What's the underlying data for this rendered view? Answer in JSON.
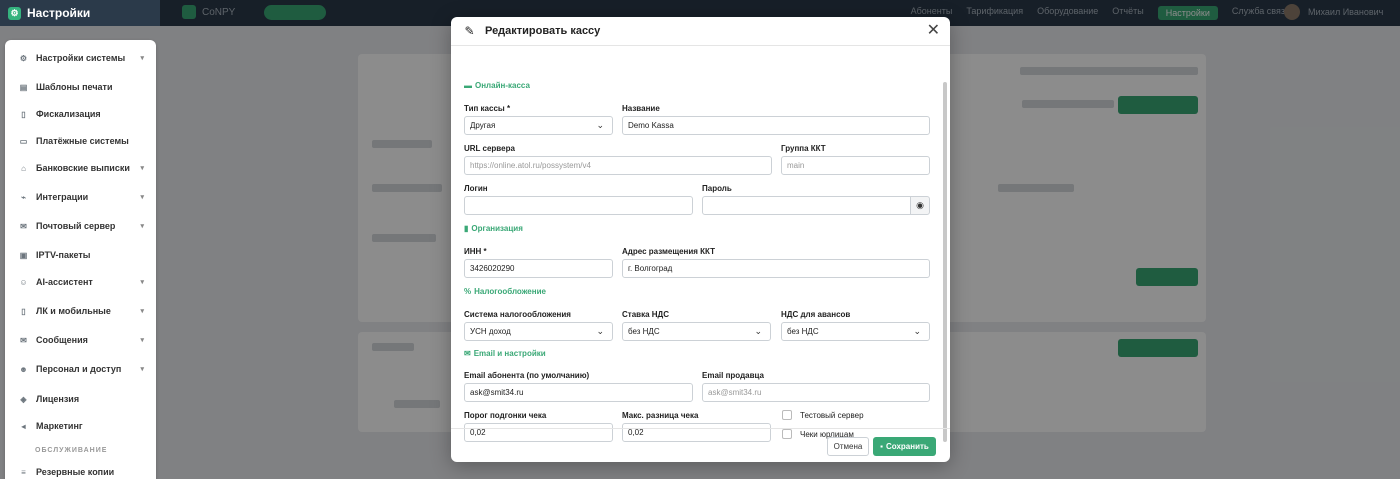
{
  "topbar": {
    "brand": "Настройки",
    "app_name": "CoNPY",
    "links": [
      "Абоненты",
      "Тарификация",
      "Оборудование",
      "Отчёты",
      "Настройки",
      "Служба связи"
    ],
    "user": "Михаил Иванович"
  },
  "sidebar": {
    "items": [
      {
        "label": "Настройки системы",
        "icon": "gears-icon",
        "chevron": true
      },
      {
        "label": "Шаблоны печати",
        "icon": "printer-icon",
        "chevron": false
      },
      {
        "label": "Фискализация",
        "icon": "receipt-icon",
        "chevron": false
      },
      {
        "label": "Платёжные системы",
        "icon": "credit-card-icon",
        "chevron": false
      },
      {
        "label": "Банковские выписки",
        "icon": "bank-icon",
        "chevron": true
      },
      {
        "label": "Интеграции",
        "icon": "plug-icon",
        "chevron": true
      },
      {
        "label": "Почтовый сервер",
        "icon": "envelope-icon",
        "chevron": true
      },
      {
        "label": "IPTV-пакеты",
        "icon": "tv-icon",
        "chevron": false
      },
      {
        "label": "AI-ассистент",
        "icon": "robot-icon",
        "chevron": true
      },
      {
        "label": "ЛК и мобильные",
        "icon": "mobile-icon",
        "chevron": true
      },
      {
        "label": "Сообщения",
        "icon": "message-icon",
        "chevron": true
      },
      {
        "label": "Персонал и доступ",
        "icon": "users-icon",
        "chevron": true
      },
      {
        "label": "Лицензия",
        "icon": "shield-icon",
        "chevron": false
      },
      {
        "label": "Маркетинг",
        "icon": "megaphone-icon",
        "chevron": false
      }
    ],
    "section_label": "ОБСЛУЖИВАНИЕ",
    "after_section": [
      {
        "label": "Резервные копии",
        "icon": "database-icon",
        "chevron": false
      }
    ]
  },
  "modal": {
    "title": "Редактировать кассу",
    "sections": {
      "online": "Онлайн-касса",
      "org": "Организация",
      "tax": "Налогообложение",
      "email": "Email и настройки"
    },
    "fields": {
      "type_label": "Тип кассы *",
      "type_value": "Другая",
      "name_label": "Название",
      "name_value": "Demo Kassa",
      "url_label": "URL сервера",
      "url_placeholder": "https://online.atol.ru/possystem/v4",
      "group_label": "Группа ККТ",
      "group_placeholder": "main",
      "login_label": "Логин",
      "login_value": "",
      "password_label": "Пароль",
      "password_value": "",
      "inn_label": "ИНН *",
      "inn_value": "3426020290",
      "address_label": "Адрес размещения ККТ",
      "address_value": "г. Волгоград",
      "taxsys_label": "Система налогообложения",
      "taxsys_value": "УСН доход",
      "vat_label": "Ставка НДС",
      "vat_value": "без НДС",
      "vat_adv_label": "НДС для авансов",
      "vat_adv_value": "без НДС",
      "email_sub_label": "Email абонента (по умолчанию)",
      "email_sub_value": "ask@smit34.ru",
      "email_seller_label": "Email продавца",
      "email_seller_placeholder": "ask@smit34.ru",
      "threshold_label": "Порог подгонки чека",
      "threshold_value": "0,02",
      "maxdiff_label": "Макс. разница чека",
      "maxdiff_value": "0,02",
      "test_server_label": "Тестовый сервер",
      "legal_checks_label": "Чеки юрлицам"
    },
    "buttons": {
      "cancel": "Отмена",
      "save": "Сохранить"
    }
  },
  "colors": {
    "accent": "#3aa876",
    "topbar": "#2b3a4a"
  }
}
